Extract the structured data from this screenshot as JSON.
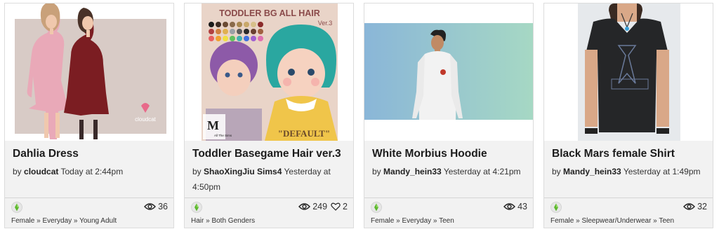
{
  "cards": [
    {
      "title": "Dahlia Dress",
      "by": "by",
      "author": "cloudcat",
      "time": "Today at 2:44pm",
      "views": "36",
      "likes": null,
      "category": "Female » Everyday » Young Adult",
      "watermark": "cloudcat"
    },
    {
      "title": "Toddler Basegame Hair ver.3",
      "by": "by",
      "author": "ShaoXingJiu Sims4",
      "time": "Yesterday at 4:50pm",
      "views": "249",
      "likes": "2",
      "category": "Hair » Both Genders",
      "banner": "TODDLER BG ALL HAIR",
      "version": "Ver.3",
      "label": "\"DEFAULT\"",
      "logo_letter": "M",
      "logo_text": "All The Sims"
    },
    {
      "title": "White Morbius Hoodie",
      "by": "by",
      "author": "Mandy_hein33",
      "time": "Yesterday at 4:21pm",
      "views": "43",
      "likes": null,
      "category": "Female » Everyday » Teen"
    },
    {
      "title": "Black Mars female Shirt",
      "by": "by",
      "author": "Mandy_hein33",
      "time": "Yesterday at 1:49pm",
      "views": "32",
      "likes": null,
      "category": "Female » Sleepwear/Underwear » Teen"
    }
  ],
  "colors": {
    "card_bg": "#f2f2f2",
    "plumbob": "#5cb82e",
    "text": "#222222"
  }
}
